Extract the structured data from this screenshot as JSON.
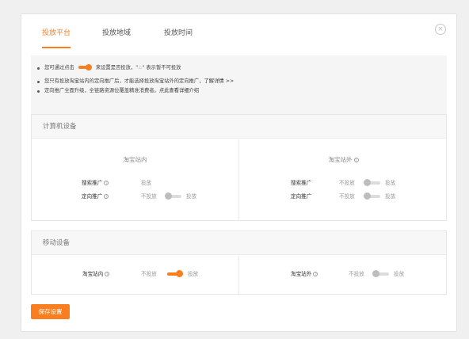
{
  "tabs": [
    "投放平台",
    "投放地域",
    "投放时间"
  ],
  "close_glyph": "×",
  "notice": {
    "line1_prefix": "您可通过点击",
    "line1_mid": "来设置是否投放，\"",
    "line1_warn": "⚠",
    "line1_suffix": "\" 表示暂不可投放",
    "line2": "您只有投放淘宝站内的定向推广后，才能选择投放淘宝站外的定向推广，",
    "line2_link": "了解详情 >>",
    "line3": "定向推广全面升级，全链路资源位覆盖精准消费者。",
    "line3_link": "点此查看详细介绍"
  },
  "computer": {
    "title": "计算机设备",
    "inside": {
      "title": "淘宝站内",
      "search_label": "搜索推广",
      "search_value": "投放",
      "target_label": "定向推广",
      "target_off": "不投放",
      "target_on": "投放",
      "target_enabled": false
    },
    "outside": {
      "title": "淘宝站外",
      "search_label": "搜索推广",
      "search_off": "不投放",
      "search_on": "投放",
      "search_enabled": false,
      "target_label": "定向推广",
      "target_off": "不投放",
      "target_on": "投放",
      "target_enabled": false
    }
  },
  "mobile": {
    "title": "移动设备",
    "inside": {
      "label": "淘宝站内",
      "off": "不投放",
      "on": "投放",
      "enabled": true
    },
    "outside": {
      "label": "淘宝站外",
      "off": "不投放",
      "on": "投放",
      "enabled": false
    }
  },
  "save_label": "保存设置",
  "help_glyph": "?",
  "accent_color": "#f97e1f"
}
